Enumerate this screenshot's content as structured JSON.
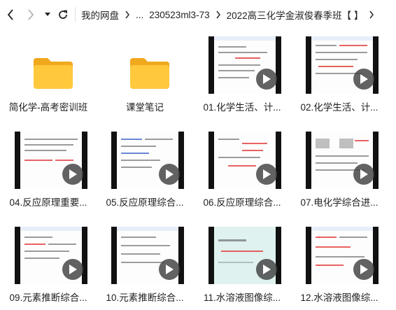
{
  "toolbar": {
    "back_icon": "chevron-left-icon",
    "forward_icon": "chevron-right-icon",
    "dropdown_icon": "caret-down-icon",
    "refresh_icon": "refresh-icon"
  },
  "breadcrumb": {
    "items": [
      "我的网盘",
      "...",
      "230523ml3-73",
      "2022高三化学金淑俊春季班【 】"
    ],
    "separator_icon": "chevron-right-icon"
  },
  "files": [
    {
      "name": "简化学-高考密训班",
      "type": "folder"
    },
    {
      "name": "课堂笔记",
      "type": "folder"
    },
    {
      "name": "01.化学生活、计...",
      "type": "video"
    },
    {
      "name": "02.化学生活、计...",
      "type": "video"
    },
    {
      "name": "04.反应原理重要...",
      "type": "video"
    },
    {
      "name": "05.反应原理综合...",
      "type": "video"
    },
    {
      "name": "06.反应原理综合...",
      "type": "video"
    },
    {
      "name": "07.电化学综合进...",
      "type": "video"
    },
    {
      "name": "09.元素推断综合...",
      "type": "video"
    },
    {
      "name": "10.元素推断综合...",
      "type": "video"
    },
    {
      "name": "11.水溶液图像综...",
      "type": "video"
    },
    {
      "name": "12.水溶液图像综...",
      "type": "video"
    }
  ],
  "colors": {
    "folder_body": "#ffc83d",
    "folder_back": "#f0a81c",
    "play_button": "#464646"
  }
}
